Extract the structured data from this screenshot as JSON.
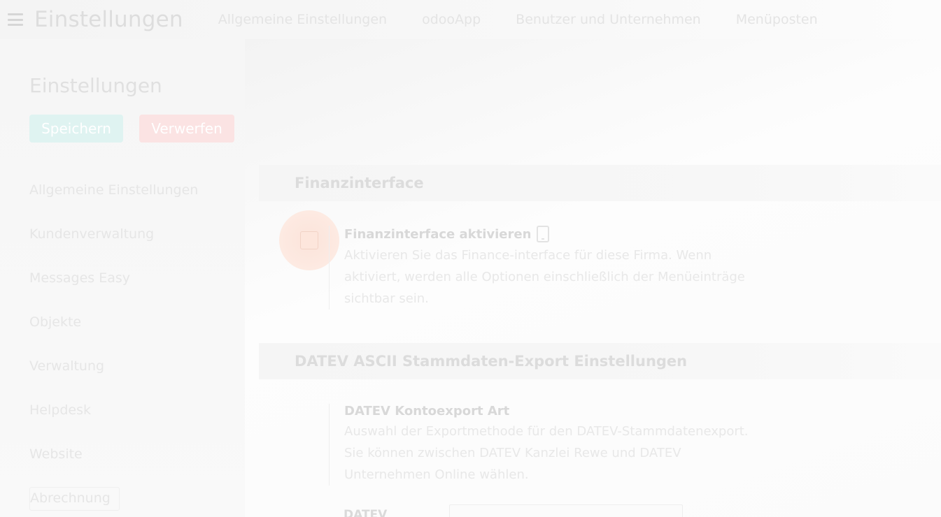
{
  "topbar": {
    "app_title": "Einstellungen",
    "menu": [
      "Allgemeine Einstellungen",
      "odooApp",
      "Benutzer und Unternehmen",
      "Menüposten"
    ]
  },
  "sidebar": {
    "title": "Einstellungen",
    "save_label": "Speichern",
    "discard_label": "Verwerfen",
    "items": [
      "Allgemeine Einstellungen",
      "Kundenverwaltung",
      "Messages Easy",
      "Objekte",
      "Verwaltung",
      "Helpdesk",
      "Website",
      "Abrechnung"
    ]
  },
  "sections": {
    "finance": {
      "heading": "Finanzinterface",
      "setting_title": "Finanzinterface aktivieren",
      "setting_desc": "Aktivieren Sie das Finance-interface für diese Firma. Wenn aktiviert, werden alle Optionen einschließlich der Menüeinträge sichtbar sein."
    },
    "datev": {
      "heading": "DATEV ASCII Stammdaten-Export Einstellungen",
      "setting_title": "DATEV Kontoexport Art",
      "setting_desc": "Auswahl der Exportmethode für den DATEV-Stammdatenexport. Sie können zwischen DATEV Kanzlei Rewe und DATEV Unternehmen Online wählen.",
      "field_label": "DATEV"
    }
  },
  "colors": {
    "save_button": "#dff3f1",
    "discard_button": "#fbe3e3",
    "checkbox_accent": "#fde6dc"
  },
  "icons": {
    "menu": "hamburger-menu-icon",
    "company_scope": "device-icon"
  }
}
